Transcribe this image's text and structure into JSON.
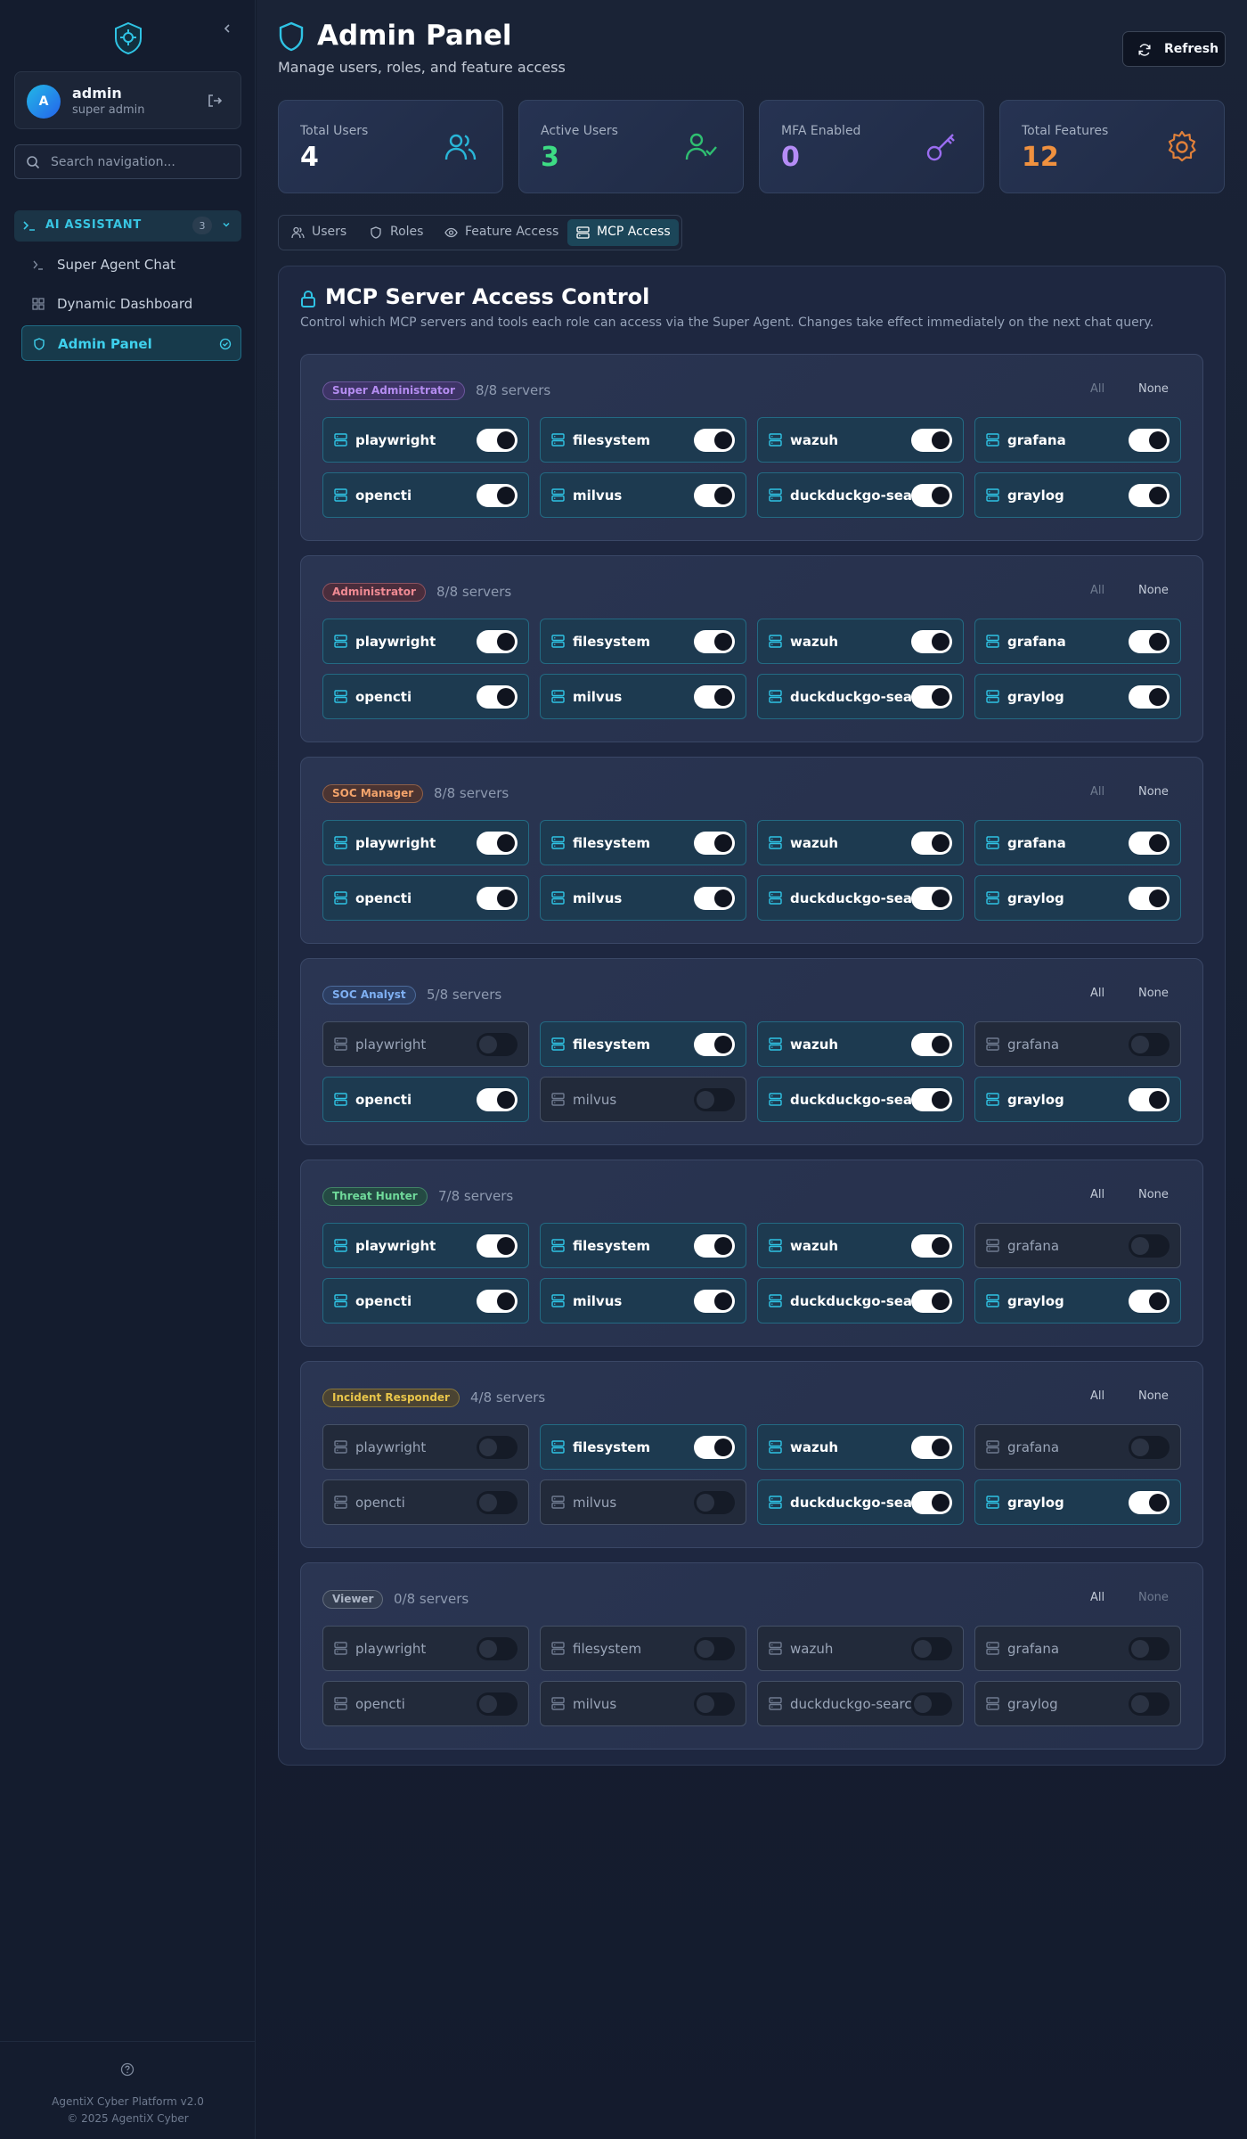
{
  "sidebar": {
    "user": {
      "initial": "A",
      "name": "admin",
      "role": "super admin"
    },
    "search_placeholder": "Search navigation...",
    "group": {
      "label": "AI ASSISTANT",
      "count": "3"
    },
    "items": [
      {
        "label": "Super Agent Chat",
        "icon": "terminal-icon"
      },
      {
        "label": "Dynamic Dashboard",
        "icon": "dashboard-icon"
      },
      {
        "label": "Admin Panel",
        "icon": "shield-icon",
        "active": true
      }
    ],
    "footer": {
      "version": "AgentiX Cyber Platform v2.0",
      "copyright": "© 2025 AgentiX Cyber"
    }
  },
  "header": {
    "title": "Admin Panel",
    "subtitle": "Manage users, roles, and feature access",
    "refresh_label": "Refresh"
  },
  "stats": [
    {
      "label": "Total Users",
      "value": "4",
      "color": "#ffffff",
      "icon": "users-icon",
      "icon_color": "#29b6d8"
    },
    {
      "label": "Active Users",
      "value": "3",
      "color": "#3ddc84",
      "icon": "user-check-icon",
      "icon_color": "#2fbf71"
    },
    {
      "label": "MFA Enabled",
      "value": "0",
      "color": "#b58cf6",
      "icon": "key-icon",
      "icon_color": "#9b6df0"
    },
    {
      "label": "Total Features",
      "value": "12",
      "color": "#f0913f",
      "icon": "gear-icon",
      "icon_color": "#e0803a"
    }
  ],
  "tabs": [
    {
      "label": "Users",
      "icon": "users-icon"
    },
    {
      "label": "Roles",
      "icon": "shield-icon"
    },
    {
      "label": "Feature Access",
      "icon": "eye-icon"
    },
    {
      "label": "MCP Access",
      "icon": "server-icon",
      "active": true
    }
  ],
  "mcp": {
    "title": "MCP Server Access Control",
    "description": "Control which MCP servers and tools each role can access via the Super Agent. Changes take effect immediately on the next chat query.",
    "all_label": "All",
    "none_label": "None",
    "servers": [
      "playwright",
      "filesystem",
      "wazuh",
      "grafana",
      "opencti",
      "milvus",
      "duckduckgo-search",
      "graylog"
    ],
    "roles": [
      {
        "name": "Super Administrator",
        "count": "8/8 servers",
        "badge_color": "#b48cf0",
        "badge_bg": "#3d3466",
        "access": [
          true,
          true,
          true,
          true,
          true,
          true,
          true,
          true
        ]
      },
      {
        "name": "Administrator",
        "count": "8/8 servers",
        "badge_color": "#f08a93",
        "badge_bg": "#4a2d3c",
        "access": [
          true,
          true,
          true,
          true,
          true,
          true,
          true,
          true
        ]
      },
      {
        "name": "SOC Manager",
        "count": "8/8 servers",
        "badge_color": "#f3a36b",
        "badge_bg": "#4b3432",
        "access": [
          true,
          true,
          true,
          true,
          true,
          true,
          true,
          true
        ]
      },
      {
        "name": "SOC Analyst",
        "count": "5/8 servers",
        "badge_color": "#7fb0f3",
        "badge_bg": "#2c3e62",
        "access": [
          false,
          true,
          true,
          false,
          true,
          false,
          true,
          true
        ]
      },
      {
        "name": "Threat Hunter",
        "count": "7/8 servers",
        "badge_color": "#6fd99a",
        "badge_bg": "#244a43",
        "access": [
          true,
          true,
          true,
          false,
          true,
          true,
          true,
          true
        ]
      },
      {
        "name": "Incident Responder",
        "count": "4/8 servers",
        "badge_color": "#e8c54a",
        "badge_bg": "#4a4332",
        "access": [
          false,
          true,
          true,
          false,
          false,
          false,
          true,
          true
        ]
      },
      {
        "name": "Viewer",
        "count": "0/8 servers",
        "badge_color": "#aab4c4",
        "badge_bg": "#343e51",
        "access": [
          false,
          false,
          false,
          false,
          false,
          false,
          false,
          false
        ]
      }
    ]
  }
}
